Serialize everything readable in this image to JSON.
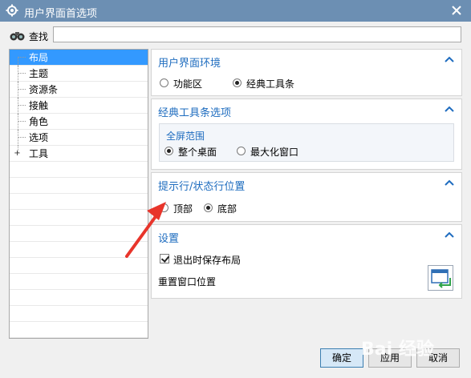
{
  "window": {
    "title": "用户界面首选项"
  },
  "search": {
    "label": "查找",
    "value": "",
    "placeholder": ""
  },
  "tree": {
    "items": [
      {
        "label": "布局",
        "selected": true
      },
      {
        "label": "主题"
      },
      {
        "label": "资源条"
      },
      {
        "label": "接触"
      },
      {
        "label": "角色"
      },
      {
        "label": "选项"
      },
      {
        "label": "工具",
        "expander": "+"
      }
    ]
  },
  "sections": {
    "env": {
      "title": "用户界面环境",
      "options": [
        "功能区",
        "经典工具条"
      ],
      "selected": "经典工具条"
    },
    "classic": {
      "title": "经典工具条选项",
      "group_title": "全屏范围",
      "options": [
        "整个桌面",
        "最大化窗口"
      ],
      "selected": "整个桌面"
    },
    "prompt": {
      "title": "提示行/状态行位置",
      "options": [
        "顶部",
        "底部"
      ],
      "selected": "底部"
    },
    "settings": {
      "title": "设置",
      "save_layout_label": "退出时保存布局",
      "save_layout_checked": true,
      "reset_label": "重置窗口位置"
    }
  },
  "buttons": {
    "ok": "确定",
    "apply": "应用",
    "cancel": "取消"
  },
  "watermark": "Bai 经验",
  "colors": {
    "titlebar": "#6c8fb3",
    "accent": "#1e6cbf",
    "selection": "#3399ff",
    "annotation_arrow": "#e8352b"
  }
}
